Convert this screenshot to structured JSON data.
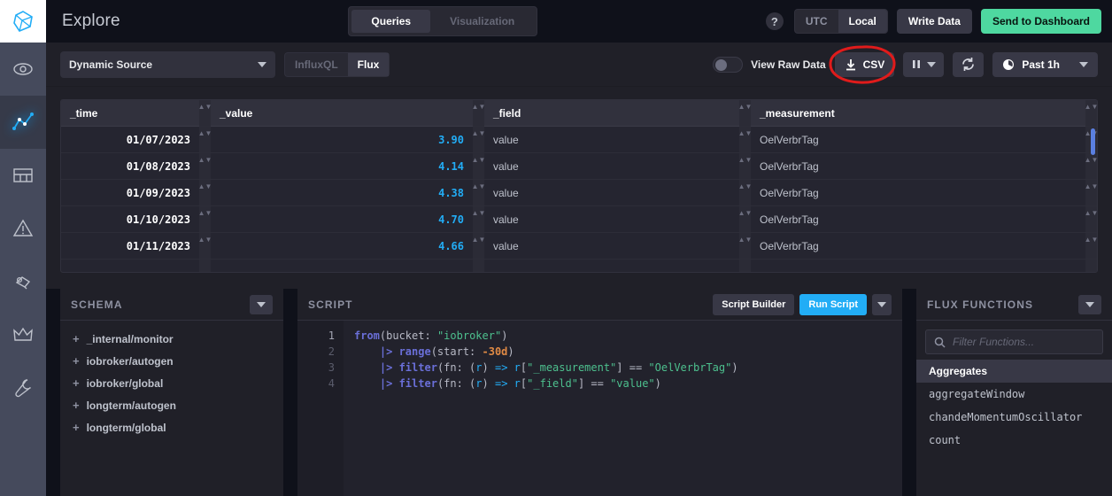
{
  "nav": {
    "logo": "influxdb-logo",
    "items": [
      {
        "name": "monitor",
        "icon": "eye-icon",
        "active": false
      },
      {
        "name": "explore",
        "icon": "graph-line-icon",
        "active": true
      },
      {
        "name": "dashboards",
        "icon": "dashboard-grid-icon",
        "active": false
      },
      {
        "name": "alerts",
        "icon": "warning-triangle-icon",
        "active": false
      },
      {
        "name": "tasks",
        "icon": "tasks-icon",
        "active": false
      },
      {
        "name": "upgrade",
        "icon": "crown-icon",
        "active": false
      },
      {
        "name": "settings",
        "icon": "wrench-icon",
        "active": false
      }
    ]
  },
  "header": {
    "title": "Explore",
    "tabs": [
      {
        "label": "Queries",
        "active": true
      },
      {
        "label": "Visualization",
        "active": false
      }
    ],
    "help_icon": "question-mark-icon",
    "timezone": [
      {
        "label": "UTC",
        "active": false
      },
      {
        "label": "Local",
        "active": true
      }
    ],
    "write_data_label": "Write Data",
    "send_dashboard_label": "Send to Dashboard"
  },
  "toolbar": {
    "source": "Dynamic Source",
    "languages": [
      {
        "label": "InfluxQL",
        "active": false
      },
      {
        "label": "Flux",
        "active": true
      }
    ],
    "raw_data_label": "View Raw Data",
    "raw_data_on": false,
    "csv_label": "CSV",
    "csv_icon": "download-icon",
    "pause_icon": "pause-icon",
    "refresh_icon": "refresh-icon",
    "clock_icon": "clock-icon",
    "time_range": "Past 1h",
    "annotation": {
      "shape": "red-ellipse",
      "color": "#e01b1b",
      "target": "csv-button"
    }
  },
  "table": {
    "columns": [
      "_time",
      "_value",
      "_field",
      "_measurement"
    ],
    "rows": [
      {
        "_time": "01/07/2023",
        "_value": "3.90",
        "_field": "value",
        "_measurement": "OelVerbrTag"
      },
      {
        "_time": "01/08/2023",
        "_value": "4.14",
        "_field": "value",
        "_measurement": "OelVerbrTag"
      },
      {
        "_time": "01/09/2023",
        "_value": "4.38",
        "_field": "value",
        "_measurement": "OelVerbrTag"
      },
      {
        "_time": "01/10/2023",
        "_value": "4.70",
        "_field": "value",
        "_measurement": "OelVerbrTag"
      },
      {
        "_time": "01/11/2023",
        "_value": "4.66",
        "_field": "value",
        "_measurement": "OelVerbrTag"
      }
    ]
  },
  "schema": {
    "title": "SCHEMA",
    "items": [
      {
        "label": "_internal/monitor"
      },
      {
        "label": "iobroker/autogen"
      },
      {
        "label": "iobroker/global"
      },
      {
        "label": "longterm/autogen"
      },
      {
        "label": "longterm/global"
      }
    ]
  },
  "script": {
    "title": "SCRIPT",
    "script_builder_label": "Script Builder",
    "run_label": "Run Script",
    "line_numbers": [
      "1",
      "2",
      "3",
      "4"
    ],
    "lines": [
      {
        "n": "1",
        "text": "from(bucket: \"iobroker\")"
      },
      {
        "n": "2",
        "text": "    |> range(start: -30d)"
      },
      {
        "n": "3",
        "text": "    |> filter(fn: (r) => r[\"_measurement\"] == \"OelVerbrTag\")"
      },
      {
        "n": "4",
        "text": "    |> filter(fn: (r) => r[\"_field\"] == \"value\")"
      }
    ],
    "tokens": {
      "bucket_name": "iobroker",
      "range_start": "-30d",
      "measurement_value": "OelVerbrTag",
      "field_value": "value"
    }
  },
  "functions": {
    "title": "FLUX FUNCTIONS",
    "search_placeholder": "Filter Functions...",
    "search_icon": "search-icon",
    "category": "Aggregates",
    "items": [
      {
        "label": "aggregateWindow"
      },
      {
        "label": "chandeMomentumOscillator"
      },
      {
        "label": "count"
      }
    ]
  },
  "colors": {
    "accent_blue": "#22adf6",
    "accent_green": "#4ed8a0",
    "annotation_red": "#e01b1b",
    "panel_bg": "#202028",
    "app_bg": "#0f111a"
  }
}
